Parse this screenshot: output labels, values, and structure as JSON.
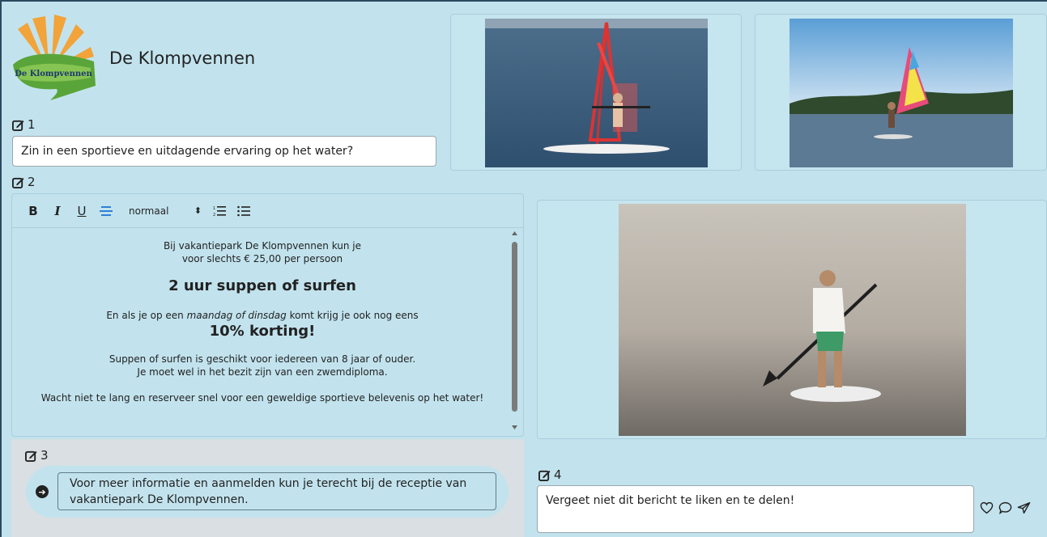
{
  "brand": {
    "name": "De Klompvennen",
    "logo_text": "De Klompvennen"
  },
  "field1": {
    "label": "1",
    "value": "Zin in een sportieve en uitdagende ervaring op het water?"
  },
  "field2": {
    "label": "2",
    "toolbar": {
      "bold": "B",
      "italic": "I",
      "underline": "U",
      "align": "≡",
      "size": "normaal",
      "size_arrows": "⬍"
    },
    "content": {
      "p1_line1": "Bij vakantiepark De Klompvennen kun je",
      "p1_line2": "voor slechts € 25,00 per persoon",
      "heading1": "2 uur suppen of surfen",
      "p2_prefix": "En als je op een ",
      "p2_italic": "maandag of dinsdag",
      "p2_suffix": " komt krijg je ook nog eens",
      "heading2": "10% korting!",
      "p3_line1": "Suppen of surfen is geschikt voor iedereen van 8 jaar of ouder.",
      "p3_line2": "Je moet wel in het bezit zijn van een zwemdiploma.",
      "p4": "Wacht niet te lang en reserveer snel voor een geweldige sportieve belevenis op het water!"
    }
  },
  "field3": {
    "label": "3",
    "value": "Voor meer informatie en aanmelden kun je terecht bij de receptie van vakantiepark De Klompvennen."
  },
  "field4": {
    "label": "4",
    "value": "Vergeet niet dit bericht te liken en te delen!"
  },
  "icons": {
    "edit": "edit-icon",
    "like": "heart-icon",
    "comment": "comment-icon",
    "share": "send-icon"
  },
  "colors": {
    "background": "#c2e3ee",
    "section3": "#d9dfe2",
    "logo_green": "#5fa83a",
    "logo_orange": "#f0a030"
  }
}
